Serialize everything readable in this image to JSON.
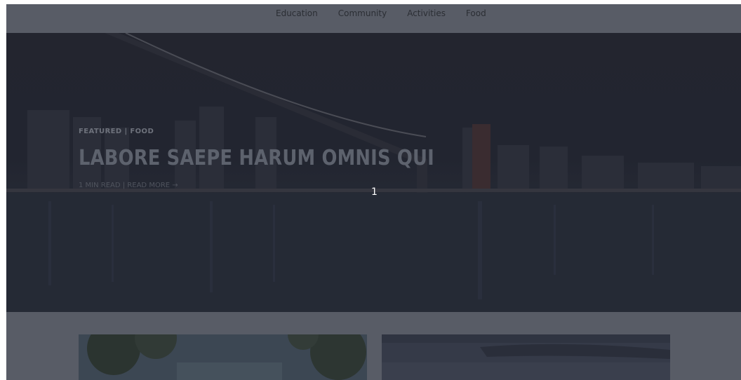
{
  "nav": {
    "items": [
      "Education",
      "Community",
      "Activities",
      "Food"
    ]
  },
  "hero": {
    "category": "FEATURED | FOOD",
    "title": "LABORE SAEPE HARUM OMNIS QUI",
    "read_time": "1 MIN READ",
    "separator": " | ",
    "read_more": "READ MORE →",
    "slide_number": "1"
  },
  "cards": [
    {
      "image": "trees-photo"
    },
    {
      "image": "water-photo"
    }
  ],
  "colors": {
    "overlay": "#585c66",
    "hero_bg": "#23252f"
  }
}
